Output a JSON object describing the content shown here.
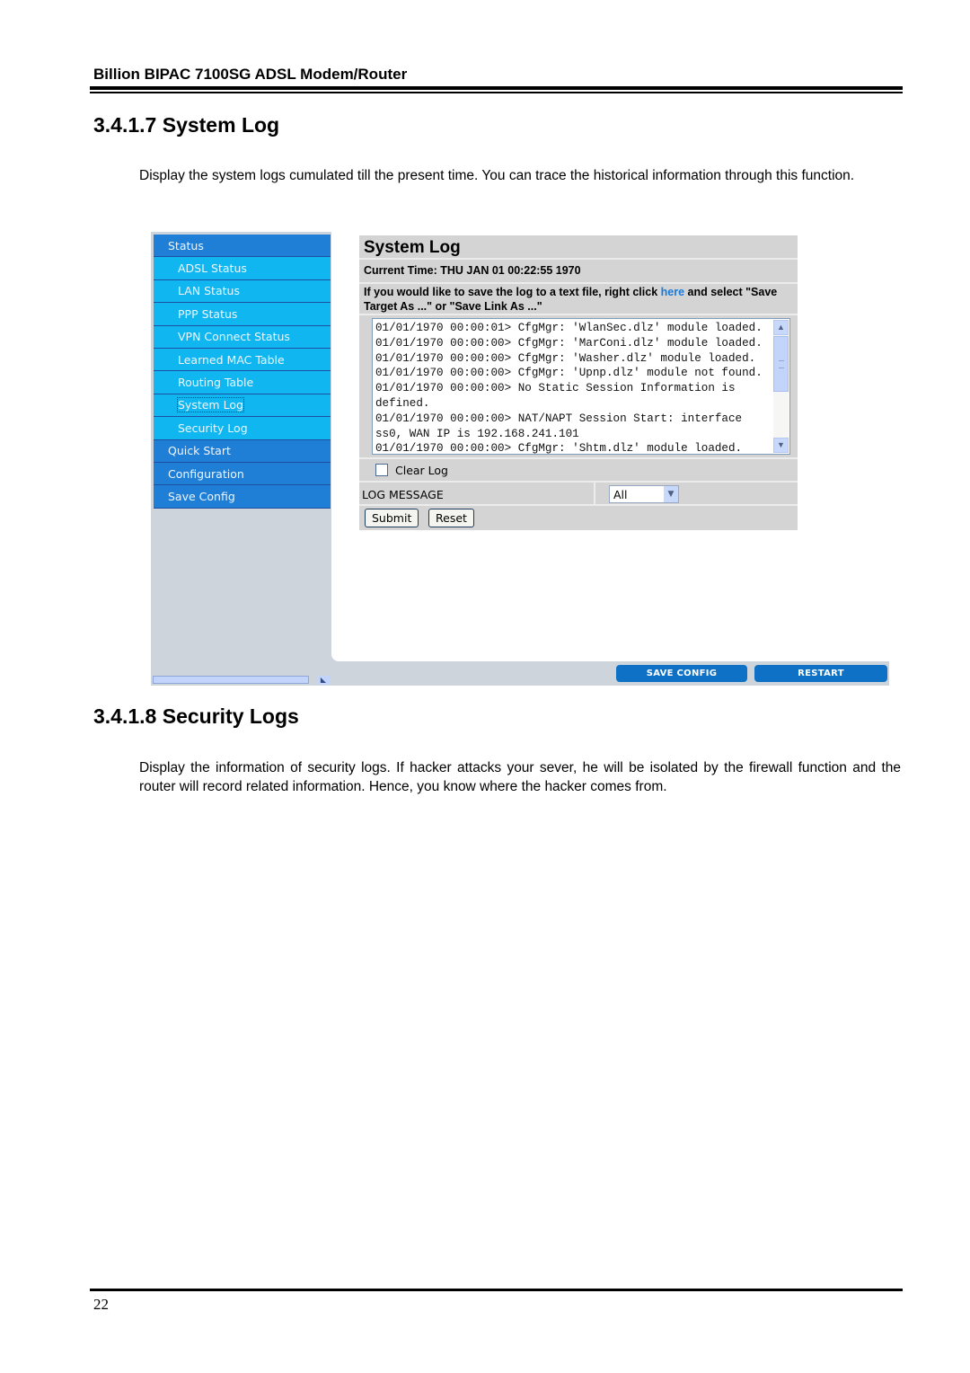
{
  "document": {
    "running_header": "Billion BIPAC 7100SG ADSL Modem/Router",
    "sections": [
      {
        "title": "3.4.1.7 System Log",
        "paragraph": "Display the system logs cumulated till the present time. You can trace the historical information through this function."
      },
      {
        "title": "3.4.1.8 Security Logs",
        "paragraph": "Display the information of security logs. If hacker attacks your sever, he will be isolated by the firewall function and the router will record related information. Hence, you know where the hacker comes from."
      }
    ],
    "page_number": "22"
  },
  "screenshot": {
    "sidebar": {
      "items": [
        {
          "label": "Status",
          "level": "main"
        },
        {
          "label": "ADSL Status",
          "level": "sub"
        },
        {
          "label": "LAN Status",
          "level": "sub"
        },
        {
          "label": "PPP Status",
          "level": "sub"
        },
        {
          "label": "VPN Connect Status",
          "level": "sub"
        },
        {
          "label": "Learned MAC Table",
          "level": "sub"
        },
        {
          "label": "Routing Table",
          "level": "sub"
        },
        {
          "label": "System Log",
          "level": "sub",
          "active": true
        },
        {
          "label": "Security Log",
          "level": "sub"
        },
        {
          "label": "Quick Start",
          "level": "main"
        },
        {
          "label": "Configuration",
          "level": "main"
        },
        {
          "label": "Save Config",
          "level": "main"
        }
      ]
    },
    "panel": {
      "title": "System Log",
      "current_time_label": "Current Time:",
      "current_time_value": "THU JAN 01 00:22:55 1970",
      "save_hint_before": "If you would like to save the log to a text file, right click ",
      "save_hint_link": "here",
      "save_hint_after": " and select \"Save Target As ...\" or \"Save Link As ...\"",
      "log_lines": [
        "01/01/1970 00:00:01> CfgMgr: 'WlanSec.dlz' module loaded.",
        "01/01/1970 00:00:00> CfgMgr: 'MarConi.dlz' module loaded.",
        "01/01/1970 00:00:00> CfgMgr: 'Washer.dlz' module loaded.",
        "01/01/1970 00:00:00> CfgMgr: 'Upnp.dlz' module not found.",
        "01/01/1970 00:00:00> No Static Session Information is",
        "defined.",
        "01/01/1970 00:00:00> NAT/NAPT Session Start: interface",
        "ss0, WAN IP is 192.168.241.101",
        "01/01/1970 00:00:00> CfgMgr: 'Shtm.dlz' module loaded."
      ],
      "clear_log_label": "Clear Log",
      "clear_log_checked": false,
      "log_message_label": "LOG MESSAGE",
      "log_message_selected": "All",
      "submit_label": "Submit",
      "reset_label": "Reset"
    },
    "bottom_bar": {
      "save_config_label": "SAVE CONFIG",
      "restart_label": "RESTART"
    },
    "icons": {
      "scroll_up": "▲",
      "scroll_down": "▼",
      "dropdown": "▼",
      "resize": "◣"
    },
    "colors": {
      "nav_main": "#1f7fd6",
      "nav_sub": "#0fb6ef",
      "link": "#1a7ad8",
      "action_button": "#0e71c6",
      "panel_bg": "#d4d4d4"
    }
  }
}
